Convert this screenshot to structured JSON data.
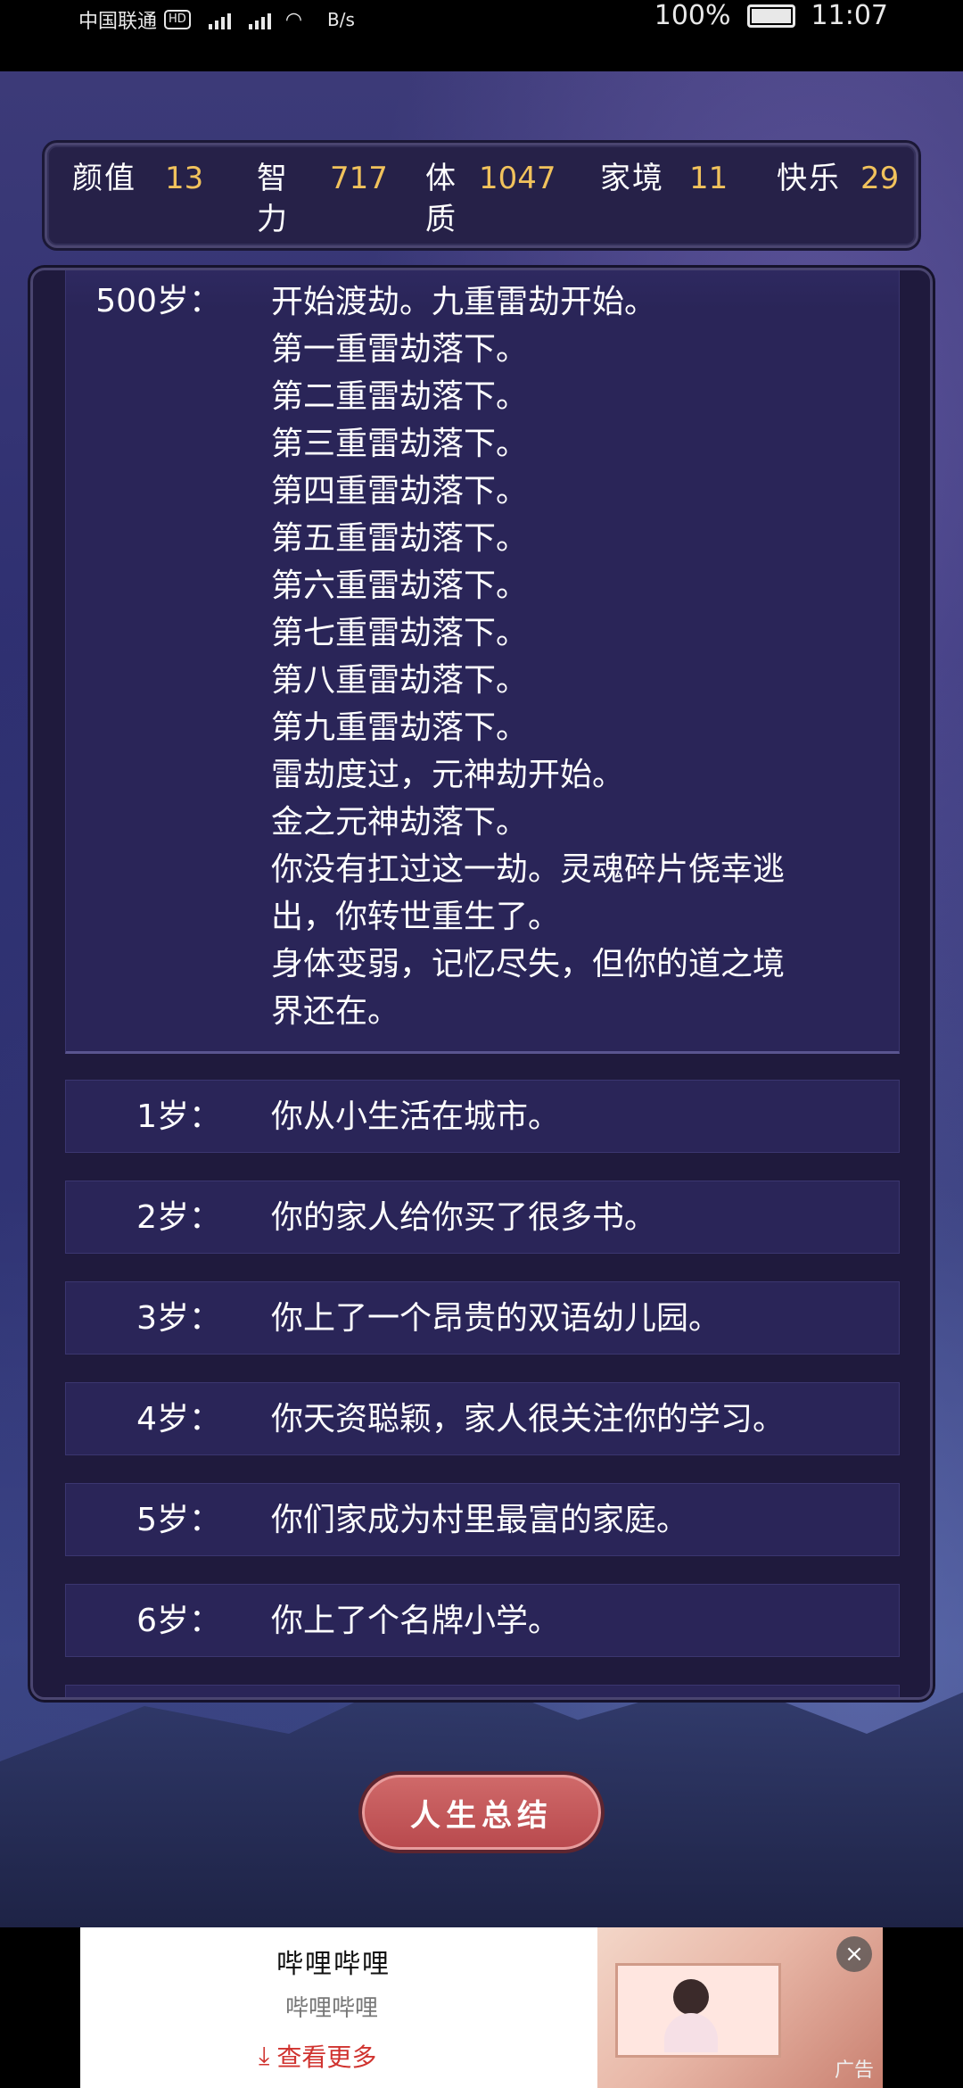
{
  "status_bar": {
    "carrier": "中国联通",
    "hd": "HD",
    "speed": "B/s",
    "battery": "100%",
    "time": "11:07"
  },
  "stats": [
    {
      "label": "颜值",
      "value": "13"
    },
    {
      "label": "智力",
      "value": "717"
    },
    {
      "label": "体质",
      "value": "1047"
    },
    {
      "label": "家境",
      "value": "11"
    },
    {
      "label": "快乐",
      "value": "29"
    }
  ],
  "log": {
    "big_entry": {
      "age": "500岁：",
      "lines": [
        "开始渡劫。九重雷劫开始。",
        "第一重雷劫落下。",
        "第二重雷劫落下。",
        "第三重雷劫落下。",
        "第四重雷劫落下。",
        "第五重雷劫落下。",
        "第六重雷劫落下。",
        "第七重雷劫落下。",
        "第八重雷劫落下。",
        "第九重雷劫落下。",
        "雷劫度过，元神劫开始。",
        "金之元神劫落下。",
        "你没有扛过这一劫。灵魂碎片侥幸逃",
        "出，你转世重生了。",
        "身体变弱，记忆尽失，但你的道之境",
        "界还在。"
      ]
    },
    "entries": [
      {
        "age": "1岁：",
        "text": "你从小生活在城市。"
      },
      {
        "age": "2岁：",
        "text": "你的家人给你买了很多书。"
      },
      {
        "age": "3岁：",
        "text": "你上了一个昂贵的双语幼儿园。"
      },
      {
        "age": "4岁：",
        "text": "你天资聪颖，家人很关注你的学习。"
      },
      {
        "age": "5岁：",
        "text": "你们家成为村里最富的家庭。"
      },
      {
        "age": "6岁：",
        "text": "你上了个名牌小学。"
      }
    ]
  },
  "summary_button": {
    "label": "人生总结"
  },
  "ad": {
    "title": "哔哩哔哩",
    "subtitle": "哔哩哔哩",
    "cta": "查看更多",
    "tag": "广告"
  }
}
